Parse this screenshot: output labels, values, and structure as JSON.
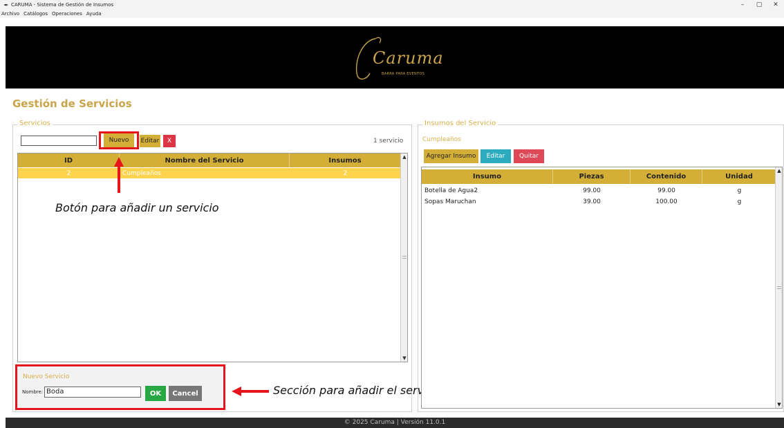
{
  "window": {
    "title": "CARUMA - Sistema de Gestión de Insumos",
    "controls": {
      "minimize": "–",
      "maximize": "▢",
      "close": "✕"
    }
  },
  "menu": [
    "Archivo",
    "Catálogos",
    "Operaciones",
    "Ayuda"
  ],
  "banner": {
    "logo_main": "Caruma",
    "logo_sub": "BARRA PARA EVENTOS"
  },
  "page_title": "Gestión de Servicios",
  "services": {
    "group_label": "Servicios",
    "search_value": "",
    "buttons": {
      "new": "Nuevo",
      "edit": "Editar",
      "delete": "X"
    },
    "count_text": "1 servicio",
    "columns": [
      "ID",
      "Nombre del Servicio",
      "Insumos"
    ],
    "rows": [
      {
        "id": "2",
        "name": "Cumpleaños",
        "insumos": "2"
      }
    ]
  },
  "new_service": {
    "title": "Nuevo Servicio",
    "name_label": "Nombre:",
    "name_value": "Boda",
    "ok": "OK",
    "cancel": "Cancel"
  },
  "insumos": {
    "group_label": "Insumos del Servicio",
    "selected_service": "Cumpleaños",
    "buttons": {
      "add": "Agregar Insumo",
      "edit": "Editar",
      "delete": "Quitar"
    },
    "columns": [
      "Insumo",
      "Piezas",
      "Contenido",
      "Unidad"
    ],
    "rows": [
      {
        "insumo": "Botella de Agua2",
        "piezas": "99.00",
        "contenido": "99.00",
        "unidad": "g"
      },
      {
        "insumo": "Sopas Maruchan",
        "piezas": "39.00",
        "contenido": "100.00",
        "unidad": "g"
      }
    ]
  },
  "annotations": {
    "nuevo_button": "Botón para añadir un servicio",
    "new_section": "Sección para añadir el servicio"
  },
  "footer": "© 2025 Caruma | Versión 11.0.1",
  "colors": {
    "gold": "#d4af37",
    "selected_row": "#ffd34d",
    "annotation_red": "#e8141c",
    "ok_green": "#28a745",
    "teal": "#17a2b8",
    "danger": "#dc3545"
  }
}
